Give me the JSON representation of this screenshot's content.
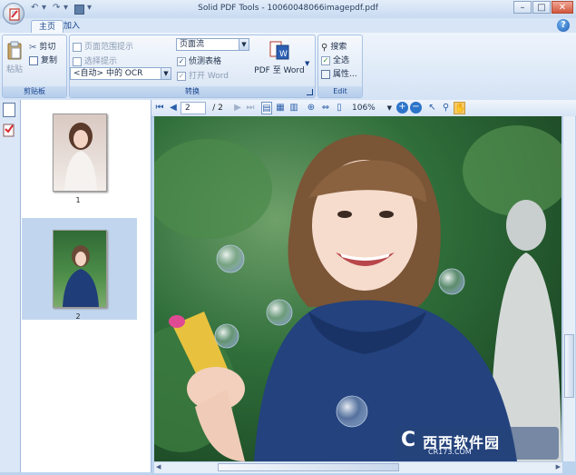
{
  "window": {
    "title": "Solid PDF Tools - 10060048066imagepdf.pdf",
    "controls": {
      "minimize": "–",
      "maximize": "□",
      "close": "✕"
    }
  },
  "tabs": [
    {
      "label": "主页",
      "active": true
    },
    {
      "label": "加入",
      "active": false
    }
  ],
  "help": "?",
  "ribbon": {
    "clipboard": {
      "label": "剪贴板",
      "paste": "粘贴",
      "cut": "剪切",
      "copy": "复制"
    },
    "convert": {
      "label": "转换",
      "check_page_range": "页面范围提示",
      "check_selection": "选择提示",
      "ocr_value": "<自动> 中的 OCR",
      "layout_value": "页面流",
      "check_detect_tables": "侦测表格",
      "check_open_word": "打开 Word",
      "pdf_to_word": "PDF 至 Word",
      "detect_tables_checked": true,
      "open_word_checked": true
    },
    "edit": {
      "label": "Edit",
      "search": "搜索",
      "select_all": "全选",
      "properties": "属性..."
    }
  },
  "viewer": {
    "page_current": "2",
    "page_total": "/ 2",
    "zoom": "106%"
  },
  "thumbnails": [
    {
      "label": "1",
      "selected": false
    },
    {
      "label": "2",
      "selected": true
    }
  ],
  "watermark": {
    "brand": "西西软件园",
    "site": "CR173.COM"
  },
  "colors": {
    "accent": "#15428b",
    "ribbon_bg": "#d4e3f5",
    "selection": "#c1d6ee"
  }
}
